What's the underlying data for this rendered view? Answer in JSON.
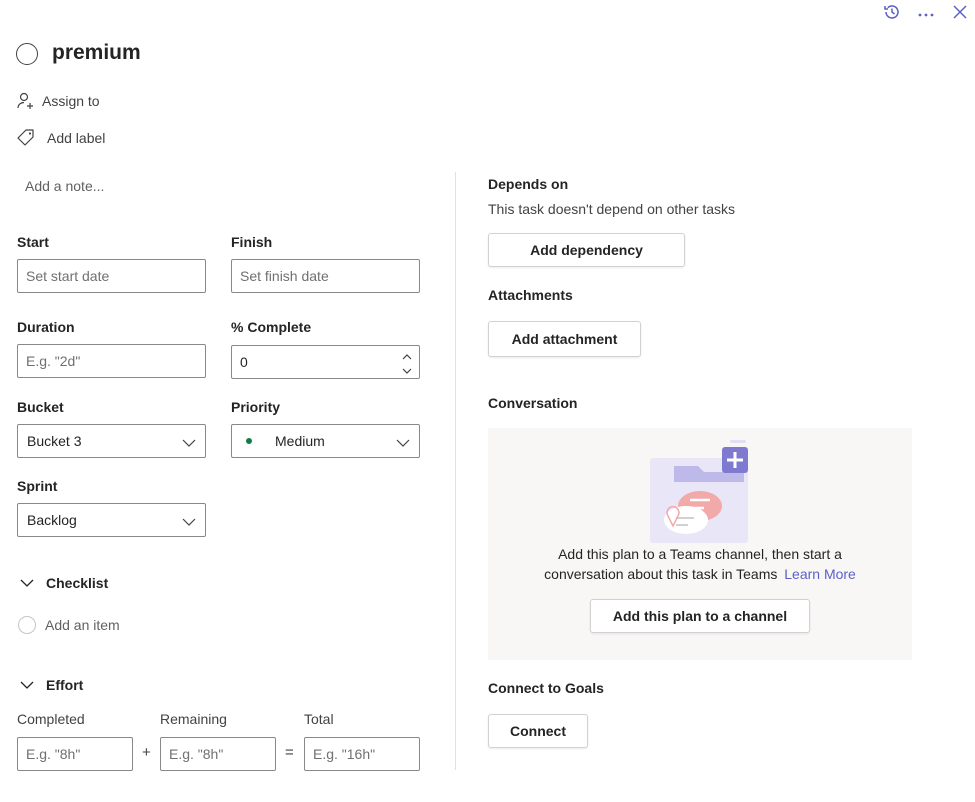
{
  "header": {
    "title": "premium",
    "history_icon": "history-icon",
    "more_icon": "more-icon",
    "close_icon": "close-icon"
  },
  "actions": {
    "assign_label": "Assign to",
    "label_label": "Add label"
  },
  "notes": {
    "placeholder": "Add a note..."
  },
  "fields": {
    "start_label": "Start",
    "start_placeholder": "Set start date",
    "finish_label": "Finish",
    "finish_placeholder": "Set finish date",
    "duration_label": "Duration",
    "duration_placeholder": "E.g. \"2d\"",
    "complete_label": "% Complete",
    "complete_value": "0",
    "bucket_label": "Bucket",
    "bucket_value": "Bucket 3",
    "priority_label": "Priority",
    "priority_value": "Medium",
    "sprint_label": "Sprint",
    "sprint_value": "Backlog"
  },
  "checklist": {
    "title": "Checklist",
    "add_item": "Add an item"
  },
  "effort": {
    "title": "Effort",
    "completed_label": "Completed",
    "completed_placeholder": "E.g. \"8h\"",
    "remaining_label": "Remaining",
    "remaining_placeholder": "E.g. \"8h\"",
    "total_label": "Total",
    "total_placeholder": "E.g. \"16h\"",
    "plus": "+",
    "equals": "="
  },
  "depends": {
    "title": "Depends on",
    "description": "This task doesn't depend on other tasks",
    "button": "Add dependency"
  },
  "attachments": {
    "title": "Attachments",
    "button": "Add attachment"
  },
  "conversation": {
    "title": "Conversation",
    "message_line1": "Add this plan to a Teams channel, then start a",
    "message_line2": "conversation about this task in Teams",
    "learn_more": "Learn More",
    "button": "Add this plan to a channel"
  },
  "goals": {
    "title": "Connect to Goals",
    "button": "Connect"
  },
  "colors": {
    "accent": "#5b5fc7",
    "priority_dot": "#107c41",
    "conversation_bg": "#f8f7f6"
  }
}
